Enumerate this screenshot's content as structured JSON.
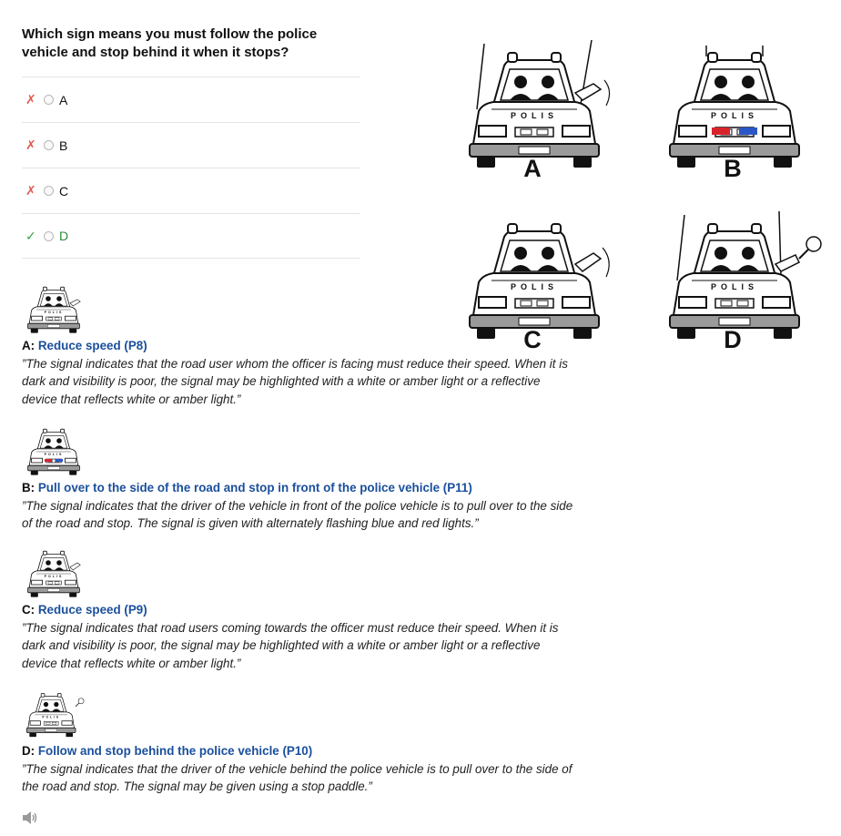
{
  "question": "Which sign means you must follow the police vehicle and stop behind it when it stops?",
  "options": [
    {
      "letter": "A",
      "mark": "✗",
      "status": "wrong"
    },
    {
      "letter": "B",
      "mark": "✗",
      "status": "wrong"
    },
    {
      "letter": "C",
      "mark": "✗",
      "status": "wrong"
    },
    {
      "letter": "D",
      "mark": "✓",
      "status": "correct"
    }
  ],
  "figure_labels": {
    "a": "A",
    "b": "B",
    "c": "C",
    "d": "D"
  },
  "car_plate_text": "POLIS",
  "explanations": [
    {
      "letter": "A:",
      "title": "Reduce speed (P8)",
      "text": "”The signal indicates that the road user whom the officer is facing must reduce their speed. When it is dark and visibility is poor, the signal may be highlighted with a white or amber light or a reflective device that reflects white or amber light.”"
    },
    {
      "letter": "B:",
      "title": "Pull over to the side of the road and stop in front of the police vehicle (P11)",
      "text": "”The signal indicates that the driver of the vehicle in front of the police vehicle is to pull over to the side of the road and stop. The signal is given with alternately flashing blue and red lights.”"
    },
    {
      "letter": "C:",
      "title": "Reduce speed (P9)",
      "text": "”The signal indicates that road users coming towards the officer must reduce their speed. When it is dark and visibility is poor, the signal may be highlighted with a white or amber light or a reflective device that reflects white or amber light.”"
    },
    {
      "letter": "D:",
      "title": "Follow and stop behind the police vehicle (P10)",
      "text": "”The signal indicates that the driver of the vehicle behind the police vehicle is to pull over to the side of the road and stop. The signal may be given using a stop paddle.”"
    }
  ],
  "colors": {
    "wrong": "#e05a4e",
    "correct": "#3fa24a",
    "link": "#1a4f9c"
  },
  "icons": {
    "audio": "speaker-icon"
  }
}
